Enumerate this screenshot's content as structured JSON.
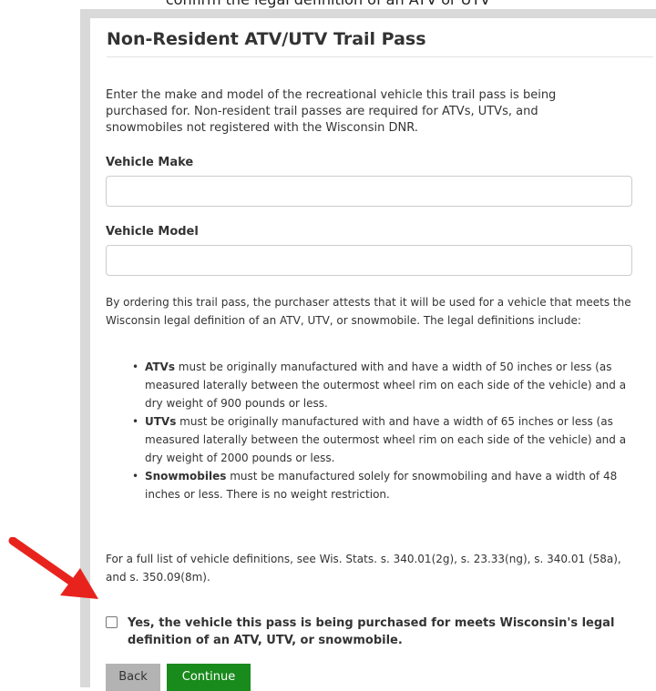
{
  "caption": "confirm the legal definition of an ATV or UTV",
  "form": {
    "title": "Non-Resident ATV/UTV Trail Pass",
    "intro": "Enter the make and model of the recreational vehicle this trail pass is being purchased for. Non-resident trail passes are required for ATVs, UTVs, and snowmobiles not registered with the Wisconsin DNR.",
    "make_label": "Vehicle Make",
    "make_value": "",
    "model_label": "Vehicle Model",
    "model_value": "",
    "attestation": "By ordering this trail pass, the purchaser attests that it will be used for a vehicle that meets the Wisconsin legal definition of an ATV, UTV, or snowmobile. The legal definitions include:",
    "definitions": [
      {
        "term": "ATVs",
        "text": " must be originally manufactured with and have a width of 50 inches or less (as measured laterally between the outermost wheel rim on each side of the vehicle) and a dry weight of 900 pounds or less."
      },
      {
        "term": "UTVs",
        "text": " must be originally manufactured with and have a width of 65 inches or less (as measured laterally between the outermost wheel rim on each side of the vehicle) and a dry weight of 2000 pounds or less."
      },
      {
        "term": "Snowmobiles",
        "text": " must be manufactured solely for snowmobiling and have a width of 48 inches or less. There is no weight restriction."
      }
    ],
    "see_also": "For a full list of vehicle definitions, see Wis. Stats. s. 340.01(2g), s. 23.33(ng), s. 340.01 (58a), and s. 350.09(8m).",
    "confirm_checked": false,
    "confirm_label": "Yes, the vehicle this pass is being purchased for meets Wisconsin's legal definition of an ATV, UTV, or snowmobile.",
    "back_label": "Back",
    "continue_label": "Continue"
  },
  "colors": {
    "continue_button": "#198a1c",
    "back_button": "#b3b3b3",
    "arrow": "#e8231d"
  },
  "icons": {
    "annotation_arrow": "red-arrow-icon"
  }
}
